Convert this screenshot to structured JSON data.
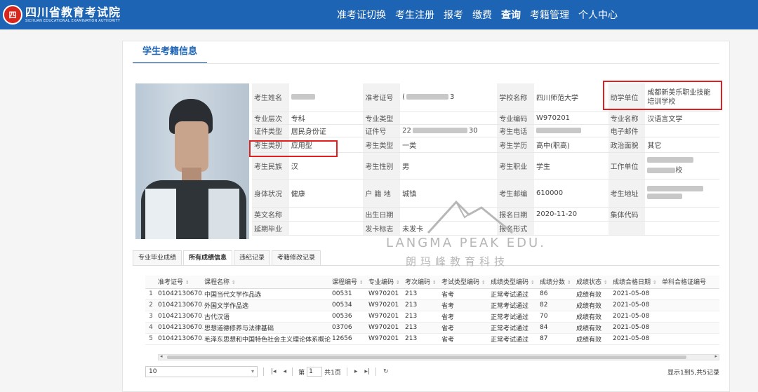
{
  "header": {
    "logo_mark": "四",
    "logo_cn": "四川省教育考试院",
    "logo_en": "SICHUAN EDUCATIONAL EXAMINATION AUTHORITY",
    "nav": [
      {
        "label": "准考证切换"
      },
      {
        "label": "考生注册"
      },
      {
        "label": "报考"
      },
      {
        "label": "缴费"
      },
      {
        "label": "查询",
        "active": true
      },
      {
        "label": "考籍管理"
      },
      {
        "label": "个人中心"
      }
    ]
  },
  "page_title": "学生考籍信息",
  "info": {
    "name_label": "考生姓名",
    "ticket_label": "准考证号",
    "ticket_value_start": "(",
    "ticket_value_end": "3",
    "school_label": "学校名称",
    "school_value": "四川师范大学",
    "assist_label": "助学单位",
    "assist_value": "成都新美乐职业技能培训学校",
    "level_label": "专业层次",
    "level_value": "专科",
    "major_type_label": "专业类型",
    "major_code_label": "专业编码",
    "major_code_value": "W970201",
    "major_name_label": "专业名称",
    "major_name_value": "汉语言文学",
    "id_type_label": "证件类型",
    "id_type_value": "居民身份证",
    "id_no_label": "证件号",
    "id_no_start": "22",
    "id_no_end": "30",
    "phone_label": "考生电话",
    "email_label": "电子邮件",
    "category_label": "考生类别",
    "category_value": "应用型",
    "exam_type_label": "考生类型",
    "exam_type_value": "一类",
    "edu_label": "考生学历",
    "edu_value": "高中(职高)",
    "politics_label": "政治面貌",
    "politics_value": "其它",
    "nation_label": "考生民族",
    "nation_value": "汉",
    "gender_label": "考生性别",
    "gender_value": "男",
    "job_label": "考生职业",
    "job_value": "学生",
    "work_label": "工作单位",
    "work_value_end": "校",
    "health_label": "身体状况",
    "health_value": "健康",
    "hukou_label": "户 籍 地",
    "hukou_value": "城镇",
    "postcode_label": "考生邮编",
    "postcode_value": "610000",
    "address_label": "考生地址",
    "eng_name_label": "英文名称",
    "birth_label": "出生日期",
    "reg_date_label": "报名日期",
    "reg_date_value": "2020-11-20",
    "group_code_label": "集体代码",
    "delay_label": "延期毕业",
    "card_flag_label": "发卡标志",
    "card_flag_value": "未发卡",
    "reg_form_label": "报名形式"
  },
  "subtabs": [
    {
      "label": "专业毕业成绩"
    },
    {
      "label": "所有成绩信息",
      "active": true
    },
    {
      "label": "违纪记录"
    },
    {
      "label": "考籍修改记录"
    }
  ],
  "grid": {
    "columns": [
      "准考证号",
      "课程名称",
      "课程编号",
      "专业编码",
      "考次编码",
      "考试类型编码",
      "成绩类型编码",
      "成绩分数",
      "成绩状态",
      "成绩合格日期",
      "单科合格证编号"
    ],
    "rows": [
      {
        "idx": "1",
        "ticket": "010421306703",
        "course": "中国当代文学作品选",
        "code": "00531",
        "major": "W970201",
        "session": "213",
        "exam_type": "省考",
        "score_type": "正常考试通过",
        "score": "86",
        "status": "成绩有效",
        "date": "2021-05-08",
        "cert": ""
      },
      {
        "idx": "2",
        "ticket": "010421306703",
        "course": "外国文学作品选",
        "code": "00534",
        "major": "W970201",
        "session": "213",
        "exam_type": "省考",
        "score_type": "正常考试通过",
        "score": "82",
        "status": "成绩有效",
        "date": "2021-05-08",
        "cert": ""
      },
      {
        "idx": "3",
        "ticket": "010421306703",
        "course": "古代汉语",
        "code": "00536",
        "major": "W970201",
        "session": "213",
        "exam_type": "省考",
        "score_type": "正常考试通过",
        "score": "70",
        "status": "成绩有效",
        "date": "2021-05-08",
        "cert": ""
      },
      {
        "idx": "4",
        "ticket": "010421306703",
        "course": "思想道德修养与法律基础",
        "code": "03706",
        "major": "W970201",
        "session": "213",
        "exam_type": "省考",
        "score_type": "正常考试通过",
        "score": "84",
        "status": "成绩有效",
        "date": "2021-05-08",
        "cert": ""
      },
      {
        "idx": "5",
        "ticket": "010421306703",
        "course": "毛泽东思想和中国特色社会主义理论体系概论",
        "code": "12656",
        "major": "W970201",
        "session": "213",
        "exam_type": "省考",
        "score_type": "正常考试通过",
        "score": "87",
        "status": "成绩有效",
        "date": "2021-05-08",
        "cert": ""
      }
    ]
  },
  "pager": {
    "page_size": "10",
    "page_prefix": "第",
    "page_value": "1",
    "page_suffix": "共1页",
    "summary": "显示1到5,共5记录"
  },
  "watermark": {
    "en": "LANGMA PEAK EDU.",
    "cn": "朗玛峰教育科技"
  },
  "colors": {
    "header_bg": "#1e64b4",
    "highlight": "#e02020"
  }
}
